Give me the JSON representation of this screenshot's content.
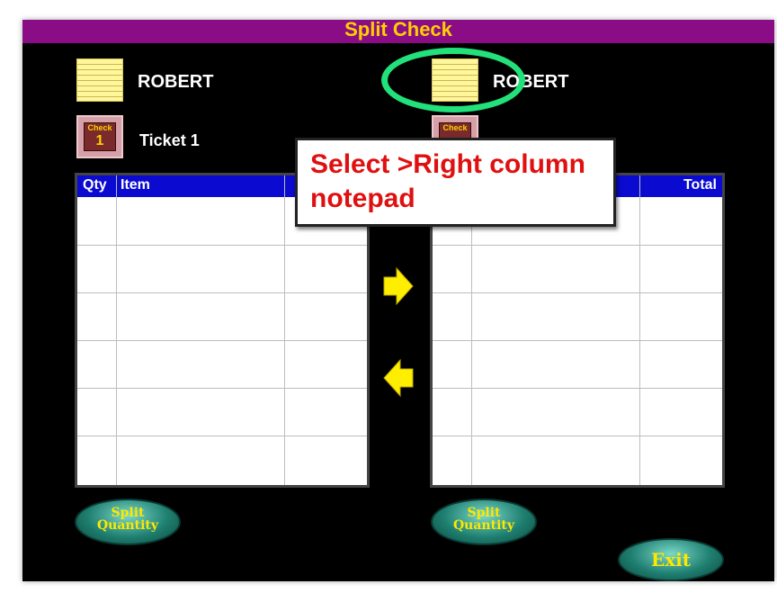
{
  "window": {
    "title": "Split Check"
  },
  "left": {
    "name": "ROBERT",
    "check_word": "Check",
    "check_number": "1",
    "ticket_label": "Ticket 1",
    "columns": [
      "Qty",
      "Item"
    ],
    "split_button": {
      "line1": "Split",
      "line2": "Quantity"
    }
  },
  "right": {
    "name": "ROBERT",
    "check_word": "Check",
    "columns": [
      "Total"
    ],
    "split_button": {
      "line1": "Split",
      "line2": "Quantity"
    }
  },
  "arrows": {
    "move_right": "arrow-right-icon",
    "move_left": "arrow-left-icon"
  },
  "exit_label": "Exit",
  "callout": {
    "line1": "Select >Right column",
    "line2": "notepad"
  },
  "colors": {
    "title_bar": "#8a0d86",
    "title_text": "#ffd000",
    "header": "#0a0ad0",
    "arrow": "#ffee00",
    "callout_text": "#e01010",
    "highlight_ring": "#22e07a"
  }
}
